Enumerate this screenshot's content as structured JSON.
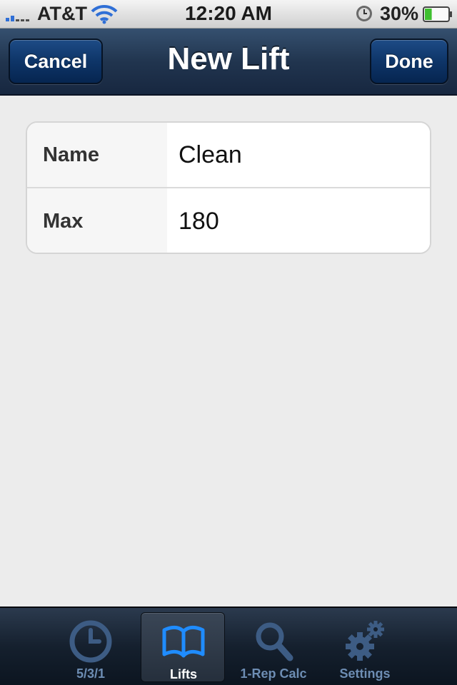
{
  "status_bar": {
    "carrier": "AT&T",
    "time": "12:20 AM",
    "battery_percent": "30%",
    "battery_level": 0.3,
    "icons": [
      "signal-icon",
      "wifi-icon",
      "alarm-icon",
      "battery-icon"
    ]
  },
  "nav": {
    "title": "New Lift",
    "cancel_label": "Cancel",
    "done_label": "Done"
  },
  "form": {
    "rows": [
      {
        "label": "Name",
        "value": "Clean"
      },
      {
        "label": "Max",
        "value": "180"
      }
    ]
  },
  "tab_bar": {
    "tabs": [
      {
        "label": "5/3/1",
        "icon": "clock-icon",
        "active": false
      },
      {
        "label": "Lifts",
        "icon": "book-icon",
        "active": true
      },
      {
        "label": "1-Rep Calc",
        "icon": "magnifier-icon",
        "active": false
      },
      {
        "label": "Settings",
        "icon": "gears-icon",
        "active": false
      }
    ]
  },
  "colors": {
    "nav_bar": "#21354f",
    "nav_button": "#0e3568",
    "active_tab_icon": "#1f8cff",
    "inactive_tab": "#6d8db3",
    "background": "#ececec"
  }
}
